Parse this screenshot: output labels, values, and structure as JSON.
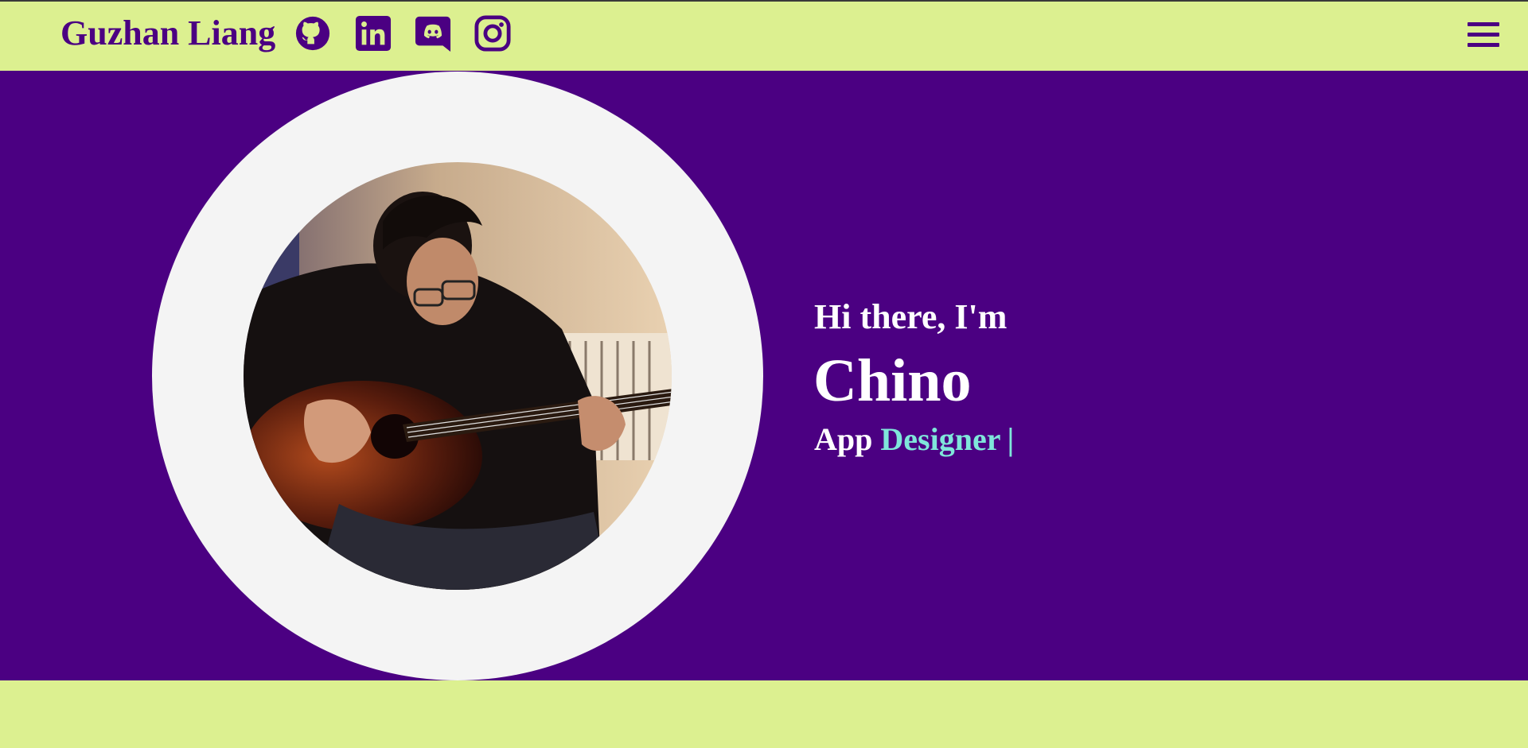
{
  "navbar": {
    "brand": "Guzhan Liang",
    "socials": [
      {
        "icon": "github-icon"
      },
      {
        "icon": "linkedin-icon"
      },
      {
        "icon": "discord-icon"
      },
      {
        "icon": "instagram-icon"
      }
    ],
    "menu_icon": "hamburger-menu-icon"
  },
  "hero": {
    "greeting": "Hi there, I'm",
    "name": "Chino",
    "role_prefix": "App",
    "role_typed": "Designer",
    "cursor": "|",
    "photo_alt": "profile-photo"
  },
  "colors": {
    "accent_bg": "#4b0082",
    "nav_bg": "#dcf090",
    "ring": "#f4f4f4",
    "highlight": "#7fe6da",
    "text": "#ffffff"
  }
}
